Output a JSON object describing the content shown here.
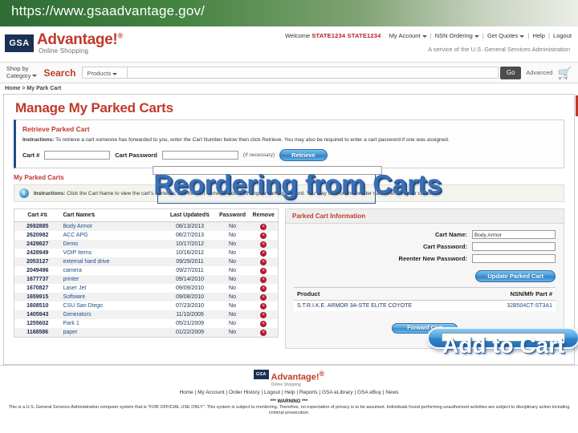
{
  "slide": {
    "url_title": "https://www.gsaadvantage.gov/"
  },
  "header": {
    "logo_mark": "GSA",
    "brand": "Advantage!",
    "brand_tm": "®",
    "tagline_small": "Online Shopping",
    "welcome_label": "Welcome",
    "user_name": "STATE1234 STATE1234",
    "nav": [
      {
        "label": "My Account",
        "caret": true
      },
      {
        "label": "NSN Ordering",
        "caret": true
      },
      {
        "label": "Get Quotes",
        "caret": true
      },
      {
        "label": "Help",
        "caret": false
      },
      {
        "label": "Logout",
        "caret": false
      }
    ],
    "agency_tagline": "A service of the U.S. General Services Administration"
  },
  "search": {
    "shop_by_line1": "Shop by",
    "shop_by_line2": "Category",
    "search_label": "Search",
    "scope_value": "Products",
    "query_value": "",
    "go_label": "Go",
    "advanced_label": "Advanced",
    "cart_icon": "cart-icon"
  },
  "breadcrumb": "Home > My Park Cart",
  "page": {
    "title": "Manage My Parked Carts"
  },
  "retrieve": {
    "panel_title": "Retrieve Parked Cart",
    "instructions_bold": "Instructions:",
    "instructions": " To retrieve a cart someone has forwarded to you, enter the Cart Number below then click Retrieve.   You may also be required to enter a cart password if one was assigned.",
    "cart_num_label": "Cart #",
    "cart_num_value": "",
    "cart_pw_label": "Cart Password",
    "cart_pw_value": "",
    "optional_note": "(If necessary)",
    "retrieve_button": "Retrieve"
  },
  "parked": {
    "section_title": "My Parked Carts",
    "instructions_bold": "Instructions:",
    "instructions": " Click the Cart Name to view the cart's contents; edit the cart name; or add or change a cart's password. You may click on the header names to sort your cart list.",
    "columns": [
      "Cart #",
      "Cart Name",
      "Last Updated",
      "Password",
      "Remove"
    ],
    "sort_glyph": "⇅",
    "remove_glyph": "×",
    "rows": [
      {
        "num": "2692885",
        "name": "Body Armor",
        "updated": "08/13/2013",
        "password": "No"
      },
      {
        "num": "2620982",
        "name": "ACC APG",
        "updated": "06/27/2013",
        "password": "No"
      },
      {
        "num": "2429827",
        "name": "Demo",
        "updated": "10/17/2012",
        "password": "No"
      },
      {
        "num": "2428949",
        "name": "VOIP Items",
        "updated": "10/16/2012",
        "password": "No"
      },
      {
        "num": "2053127",
        "name": "external hard drive",
        "updated": "09/29/2011",
        "password": "No"
      },
      {
        "num": "2049496",
        "name": "camera",
        "updated": "09/27/2011",
        "password": "No"
      },
      {
        "num": "1677737",
        "name": "printer",
        "updated": "09/14/2010",
        "password": "No"
      },
      {
        "num": "1670827",
        "name": "Laser Jet",
        "updated": "09/09/2010",
        "password": "No"
      },
      {
        "num": "1659915",
        "name": "Software",
        "updated": "09/08/2010",
        "password": "No"
      },
      {
        "num": "1608510",
        "name": "CSU San Diego",
        "updated": "07/23/2010",
        "password": "No"
      },
      {
        "num": "1405943",
        "name": "Generators",
        "updated": "11/10/2009",
        "password": "No"
      },
      {
        "num": "1255602",
        "name": "Park 1",
        "updated": "05/21/2009",
        "password": "No"
      },
      {
        "num": "1168586",
        "name": "paper",
        "updated": "01/22/2009",
        "password": "No"
      }
    ]
  },
  "cart_info": {
    "panel_title": "Parked Cart Information",
    "cart_name_label": "Cart Name:",
    "cart_name_value": "Body Armor",
    "cart_password_label": "Cart Password:",
    "cart_password_value": "",
    "reenter_password_label": "Reenter New Password:",
    "reenter_password_value": "",
    "update_button": "Update Parked Cart",
    "product_header": "Product",
    "nsn_header": "NSN/Mfr Part #",
    "product_name": "S.T.R.I.K.E. ARMOR 3A-STE ELITE COYOTE",
    "product_nsn": "32B504CT-ST3A1",
    "forward_button": "Forward Cart"
  },
  "footer": {
    "logo_mark": "GSA",
    "brand": "Advantage!",
    "brand_tm": "®",
    "brand_sub": "Online Shopping",
    "links": [
      "Home",
      "My Account",
      "Order History",
      "Logout",
      "Help",
      "Reports",
      "GSA eLibrary",
      "GSA eBuy",
      "News"
    ],
    "warning_title": "*** WARNING ***",
    "warning_body": "This is a U.S. General Services Administration computer system that is \"FOR OFFICIAL USE ONLY\". This system is subject to monitoring. Therefore, no expectation of privacy is to be assumed. Individuals found performing unauthorized activities are subject to disciplinary action including criminal prosecution."
  },
  "annotations": {
    "wordart_title": "Reordering from Carts",
    "wordart_cta": "Add to Cart"
  },
  "colors": {
    "gsa_navy": "#1b3054",
    "brand_red": "#c0392b",
    "user_red": "#b52025",
    "link_blue": "#1f4e89",
    "button_blue": "#3f93d6",
    "wordart_blue": "#3a6fb5",
    "title_band_green": "#2f6b35"
  }
}
